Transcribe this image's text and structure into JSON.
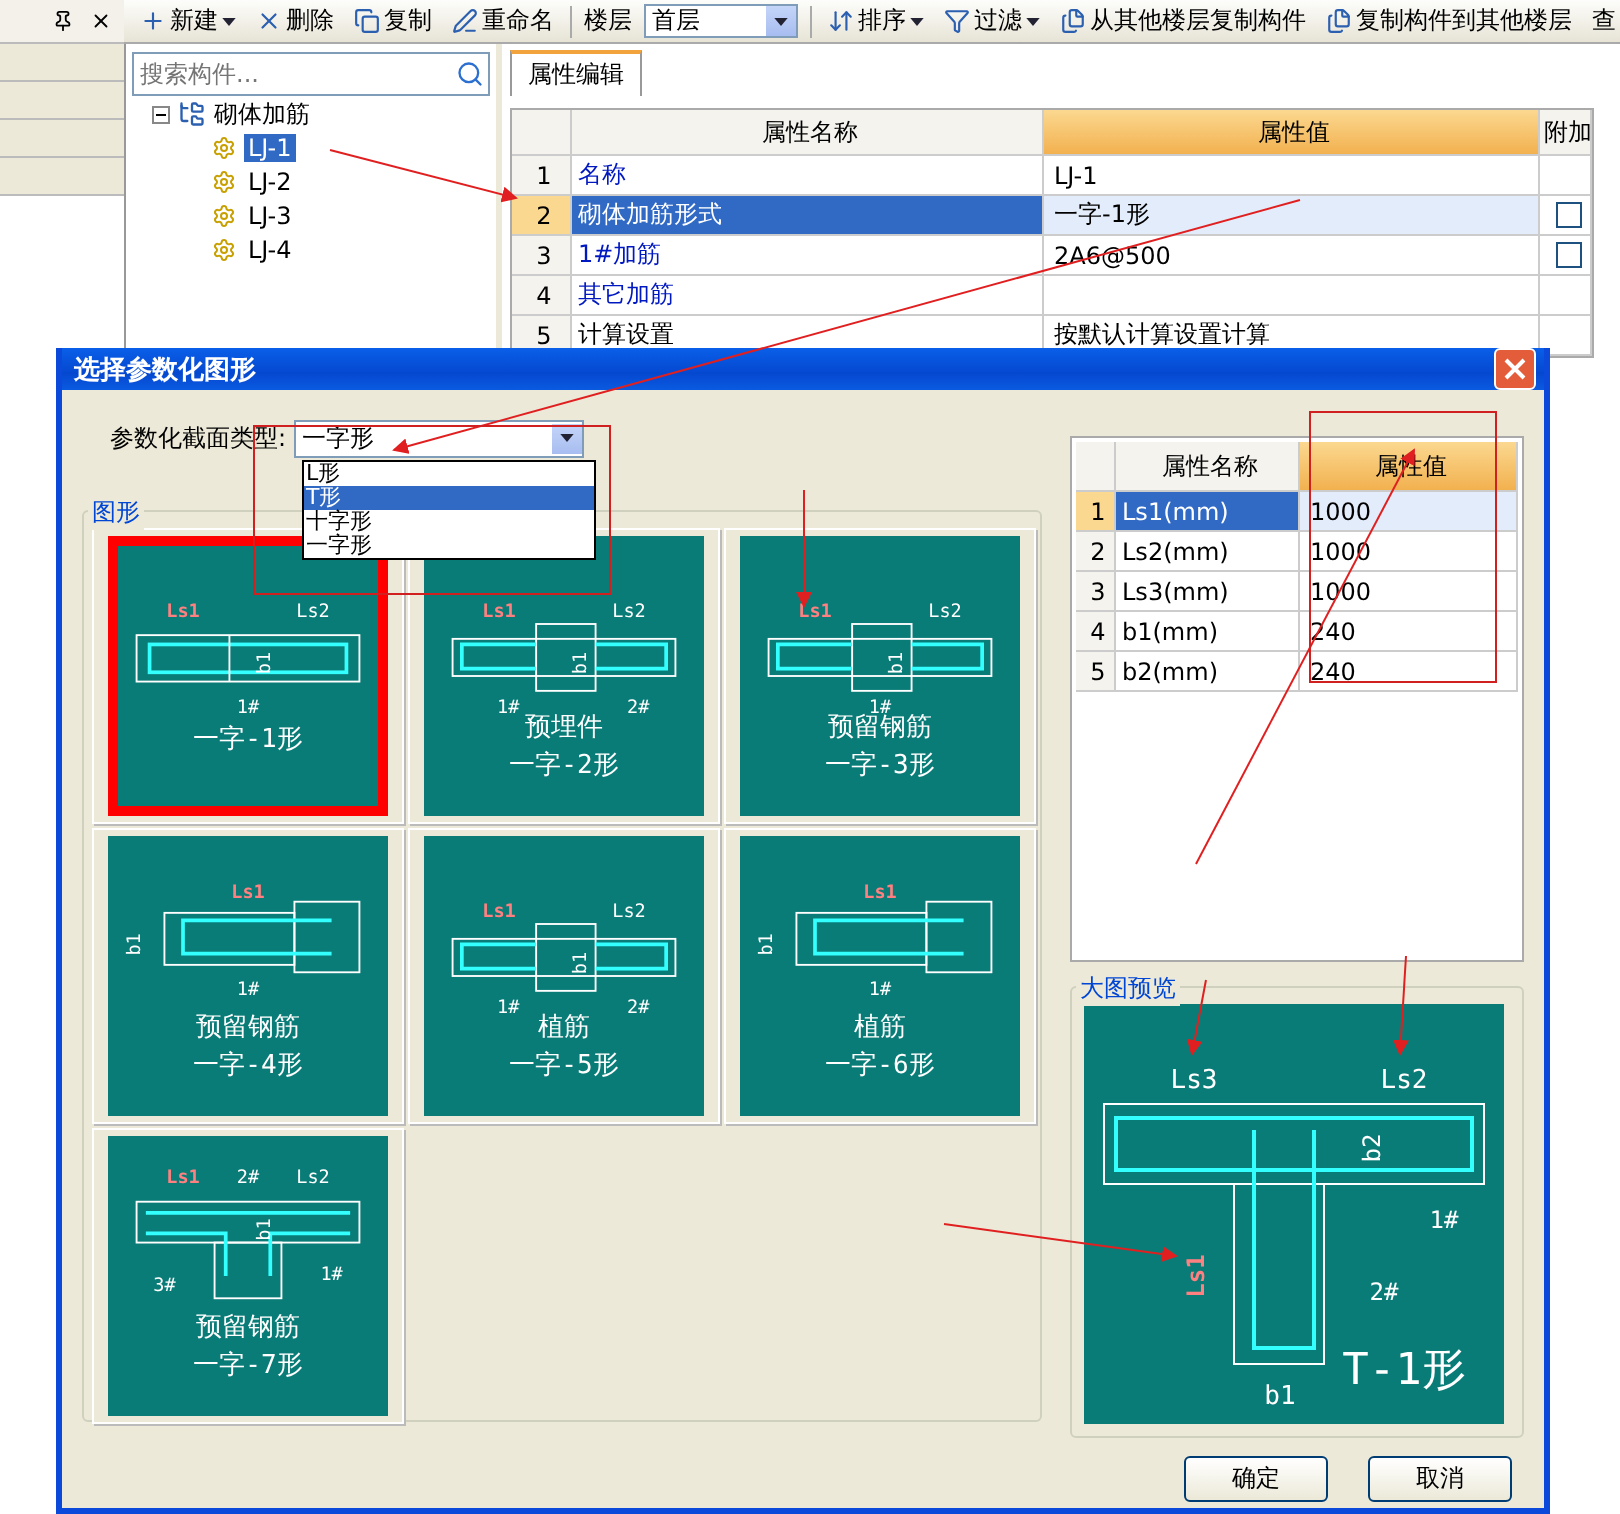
{
  "toolbar": {
    "items": [
      {
        "label": "新建",
        "menu": true
      },
      {
        "label": "删除",
        "menu": false
      },
      {
        "label": "复制",
        "menu": false
      },
      {
        "label": "重命名",
        "menu": false
      }
    ],
    "floor": {
      "label": "楼层",
      "value": "首层"
    },
    "tools": [
      {
        "label": "排序",
        "menu": true
      },
      {
        "label": "过滤",
        "menu": true
      },
      {
        "label": "从其他楼层复制构件",
        "menu": false
      },
      {
        "label": "复制构件到其他楼层",
        "menu": false
      },
      {
        "label": "查",
        "menu": false
      }
    ]
  },
  "search": {
    "placeholder": "搜索构件..."
  },
  "tree": {
    "label": "砌体加筋",
    "expanded": true,
    "children": [
      {
        "label": "LJ-1",
        "selected": true
      },
      {
        "label": "LJ-2",
        "selected": false
      },
      {
        "label": "LJ-3",
        "selected": false
      },
      {
        "label": "LJ-4",
        "selected": false
      }
    ]
  },
  "properties": {
    "tab": "属性编辑",
    "columns": [
      "属性名称",
      "属性值",
      "附加"
    ],
    "rows": [
      {
        "index": "1",
        "name": "名称",
        "value": "LJ-1",
        "link": true,
        "selected": false,
        "checkbox": false
      },
      {
        "index": "2",
        "name": "砌体加筋形式",
        "value": "一字-1形",
        "link": false,
        "selected": true,
        "checkbox": true,
        "checked": false
      },
      {
        "index": "3",
        "name": "1#加筋",
        "value": "2A6@500",
        "link": true,
        "selected": false,
        "checkbox": true,
        "checked": false
      },
      {
        "index": "4",
        "name": "其它加筋",
        "value": "",
        "link": true,
        "selected": false,
        "checkbox": false
      },
      {
        "index": "5",
        "name": "计算设置",
        "value": "按默认计算设置计算",
        "link": false,
        "selected": false,
        "checkbox": false
      }
    ]
  },
  "dialog": {
    "title": "选择参数化图形",
    "type_label": "参数化截面类型:",
    "type_value": "一字形",
    "options": [
      {
        "label": "L形",
        "selected": false
      },
      {
        "label": "T形",
        "selected": true
      },
      {
        "label": "十字形",
        "selected": false
      },
      {
        "label": "一字形",
        "selected": false
      }
    ],
    "shapes_group": "图形",
    "shapes": [
      {
        "kind": "beam",
        "selected": true,
        "dims": [
          {
            "label": "Ls1",
            "highlighted": true
          },
          {
            "label": "Ls2",
            "highlighted": false
          }
        ],
        "side": "b1",
        "bars": [
          "1#"
        ],
        "lines": [
          "一字-1形"
        ]
      },
      {
        "kind": "block",
        "selected": false,
        "dims": [
          {
            "label": "Ls1",
            "highlighted": true
          },
          {
            "label": "Ls2",
            "highlighted": false
          }
        ],
        "side": "b1",
        "bars": [
          "1#",
          "2#"
        ],
        "lines": [
          "预埋件",
          "一字-2形"
        ]
      },
      {
        "kind": "block",
        "selected": false,
        "dims": [
          {
            "label": "Ls1",
            "highlighted": true
          },
          {
            "label": "Ls2",
            "highlighted": false
          }
        ],
        "side": "b1",
        "bars": [
          "1#"
        ],
        "lines": [
          "预留钢筋",
          "一字-3形"
        ]
      },
      {
        "kind": "stub",
        "selected": false,
        "dims": [
          {
            "label": "Ls1",
            "highlighted": true
          }
        ],
        "side": "b1",
        "bars": [
          "1#"
        ],
        "lines": [
          "预留钢筋",
          "一字-4形"
        ]
      },
      {
        "kind": "block",
        "selected": false,
        "dims": [
          {
            "label": "Ls1",
            "highlighted": true
          },
          {
            "label": "Ls2",
            "highlighted": false
          }
        ],
        "side": "b1",
        "bars": [
          "1#",
          "2#"
        ],
        "lines": [
          "植筋",
          "一字-5形"
        ]
      },
      {
        "kind": "stub",
        "selected": false,
        "dims": [
          {
            "label": "Ls1",
            "highlighted": true
          }
        ],
        "side": "b1",
        "bars": [
          "1#"
        ],
        "lines": [
          "植筋",
          "一字-6形"
        ]
      },
      {
        "kind": "tee",
        "selected": false,
        "dims": [
          {
            "label": "Ls1",
            "highlighted": true
          },
          {
            "label": "Ls2",
            "highlighted": false
          }
        ],
        "side": "b1",
        "bars": [
          "3#",
          "2#",
          "1#"
        ],
        "lines": [
          "预留钢筋",
          "一字-7形"
        ]
      }
    ],
    "params": {
      "columns": [
        "属性名称",
        "属性值"
      ],
      "rows": [
        {
          "index": "1",
          "name": "Ls1(mm)",
          "value": "1000",
          "selected": true
        },
        {
          "index": "2",
          "name": "Ls2(mm)",
          "value": "1000",
          "selected": false
        },
        {
          "index": "3",
          "name": "Ls3(mm)",
          "value": "1000",
          "selected": false
        },
        {
          "index": "4",
          "name": "b1(mm)",
          "value": "240",
          "selected": false
        },
        {
          "index": "5",
          "name": "b2(mm)",
          "value": "240",
          "selected": false
        }
      ]
    },
    "preview_group": "大图预览",
    "preview": {
      "left_dim": "Ls3",
      "right_dim": "Ls2",
      "flange": "b2",
      "web_dim": "Ls1",
      "web_width": "b1",
      "bars": [
        "1#",
        "2#"
      ],
      "title": "T-1形"
    },
    "buttons": [
      "确定",
      "取消"
    ]
  }
}
